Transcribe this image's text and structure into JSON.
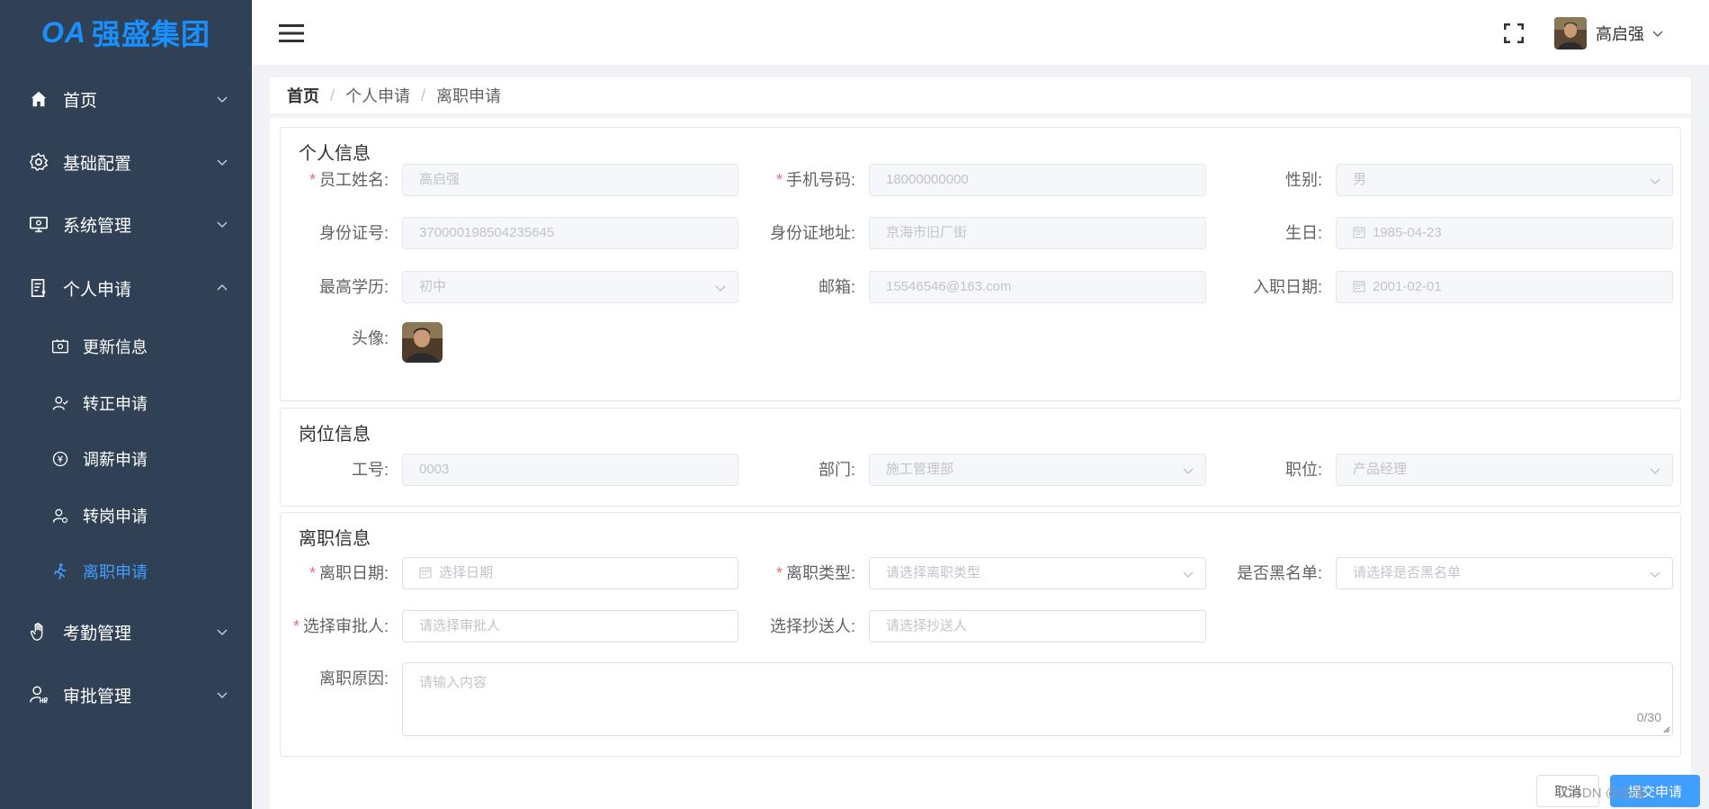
{
  "app": {
    "logo_prefix": "OA",
    "logo_text": "强盛集团"
  },
  "sidebar": {
    "items": [
      {
        "label": "首页",
        "icon": "home-icon"
      },
      {
        "label": "基础配置",
        "icon": "gear-icon"
      },
      {
        "label": "系统管理",
        "icon": "monitor-icon"
      },
      {
        "label": "个人申请",
        "icon": "document-user-icon"
      },
      {
        "label": "考勤管理",
        "icon": "hand-icon"
      },
      {
        "label": "审批管理",
        "icon": "user-hr-icon"
      }
    ],
    "sub_items": [
      {
        "label": "更新信息",
        "icon": "id-card-icon"
      },
      {
        "label": "转正申请",
        "icon": "user-check-icon"
      },
      {
        "label": "调薪申请",
        "icon": "coin-icon"
      },
      {
        "label": "转岗申请",
        "icon": "user-transfer-icon"
      },
      {
        "label": "离职申请",
        "icon": "walking-person-icon",
        "active": true
      }
    ],
    "active_color": "#409eff"
  },
  "header": {
    "user_name": "高启强"
  },
  "breadcrumb": [
    "首页",
    "个人申请",
    "离职申请"
  ],
  "personal": {
    "title": "个人信息",
    "name_label": "员工姓名:",
    "name_value": "高启强",
    "phone_label": "手机号码:",
    "phone_value": "18000000000",
    "gender_label": "性别:",
    "gender_value": "男",
    "id_label": "身份证号:",
    "id_value": "370000198504235645",
    "address_label": "身份证地址:",
    "address_value": "京海市旧厂街",
    "birthday_label": "生日:",
    "birthday_value": "1985-04-23",
    "education_label": "最高学历:",
    "education_value": "初中",
    "email_label": "邮箱:",
    "email_value": "15546546@163.com",
    "hire_date_label": "入职日期:",
    "hire_date_value": "2001-02-01",
    "avatar_label": "头像:"
  },
  "position": {
    "title": "岗位信息",
    "job_no_label": "工号:",
    "job_no_value": "0003",
    "dept_label": "部门:",
    "dept_value": "施工管理部",
    "role_label": "职位:",
    "role_value": "产品经理"
  },
  "resignation": {
    "title": "离职信息",
    "date_label": "离职日期:",
    "date_placeholder": "选择日期",
    "type_label": "离职类型:",
    "type_placeholder": "请选择离职类型",
    "blacklist_label": "是否黑名单:",
    "blacklist_placeholder": "请选择是否黑名单",
    "approver_label": "选择审批人:",
    "approver_placeholder": "请选择审批人",
    "cc_label": "选择抄送人:",
    "cc_placeholder": "请选择抄送人",
    "reason_label": "离职原因:",
    "reason_placeholder": "请输入内容",
    "counter": "0/30"
  },
  "actions": {
    "cancel": "取消",
    "submit": "提交申请"
  },
  "watermark": "CSDN @小溪"
}
